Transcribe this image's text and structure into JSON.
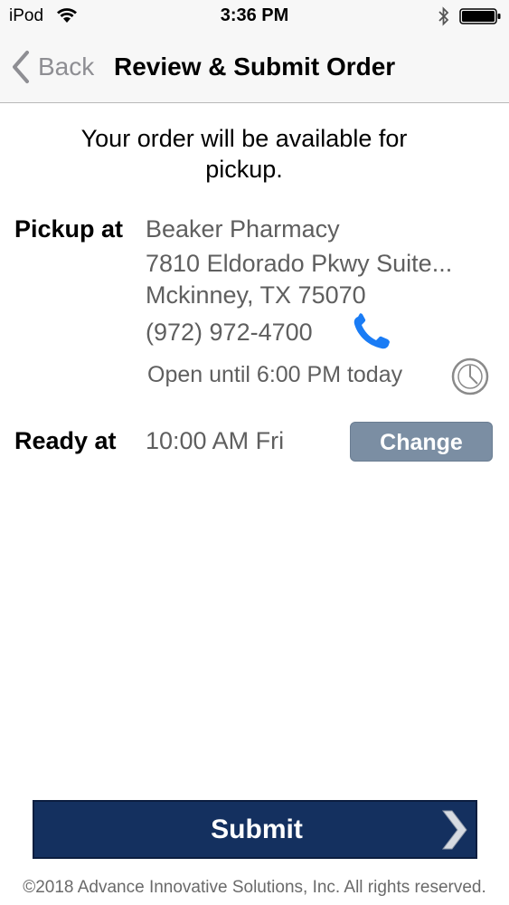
{
  "status_bar": {
    "carrier": "iPod",
    "time": "3:36 PM",
    "wifi_icon": "wifi-icon",
    "bluetooth_icon": "bluetooth-icon",
    "battery_icon": "battery-icon"
  },
  "nav": {
    "back_label": "Back",
    "title": "Review & Submit Order"
  },
  "order": {
    "intro_line1": "Your order will be available for",
    "intro_line2": "pickup."
  },
  "pickup": {
    "label": "Pickup at",
    "pharmacy_name": "Beaker Pharmacy",
    "address_line1": "7810 Eldorado Pkwy Suite...",
    "address_line2": "Mckinney, TX 75070",
    "phone": "(972) 972-4700",
    "hours": "Open until 6:00 PM today"
  },
  "ready": {
    "label": "Ready at",
    "time": "10:00 AM Fri",
    "change_label": "Change"
  },
  "submit": {
    "label": "Submit"
  },
  "footer": {
    "copyright": "©2018 Advance Innovative Solutions, Inc. All rights reserved."
  },
  "colors": {
    "accent_blue": "#1a7cf5",
    "submit_bg": "#14305f",
    "change_bg": "#7b8ea3"
  }
}
